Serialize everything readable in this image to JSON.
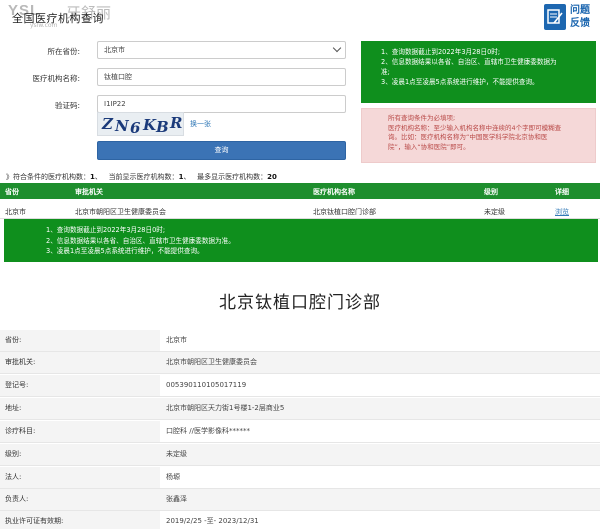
{
  "watermark": {
    "brand": "YSL",
    "brand_cn": "牙舒丽",
    "url": "yslw.com"
  },
  "app_title": "全国医疗机构查询",
  "feedback": {
    "line1": "问题",
    "line2": "反馈"
  },
  "form": {
    "province_label": "所在省份:",
    "province_value": "北京市",
    "name_label": "医疗机构名称:",
    "name_value": "钛植口腔",
    "captcha_label": "验证码:",
    "captcha_value": "I1IP22",
    "captcha_chars": [
      "Z",
      "N",
      "6",
      "K",
      "B",
      "R"
    ],
    "refresh_label": "换一张",
    "submit_label": "查询"
  },
  "notice_top": [
    "1、查询数据截止到2022年3月28日0时;",
    "2、信息数据结果以各省、自治区、直辖市卫生健康委数据为",
    "准;",
    "3、凌晨1点至凌晨5点系统进行维护，不能提供查询。"
  ],
  "notice_tip": {
    "line1": "所有查询条件为必填项;",
    "line2": "医疗机构名称：至少输入机构名称中连续的4个字即可模糊查",
    "line3": "询。比如：医疗机构名称为“中国医学科学院北京协和医",
    "line4": "院”，输入“协和医院”即可。"
  },
  "counts": {
    "matched_label": "》符合条件的医疗机构数：",
    "matched": "1",
    "shown_label": "当前显示医疗机构数：",
    "shown": "1",
    "max_label": "最多显示医疗机构数：",
    "max": "20"
  },
  "table": {
    "headers": [
      "省份",
      "审批机关",
      "医疗机构名称",
      "级别",
      "详细"
    ],
    "row": {
      "province": "北京市",
      "authority": "北京市朝阳区卫生健康委员会",
      "name": "北京钛植口腔门诊部",
      "level": "未定级",
      "detail": "浏览"
    }
  },
  "notice_bottom": [
    "1、查询数据截止到2022年3月28日0时;",
    "2、信息数据结果以各省、自治区、直辖市卫生健康委数据为准。",
    "3、凌晨1点至凌晨5点系统进行维护，不能提供查询。"
  ],
  "detail": {
    "title": "北京钛植口腔门诊部",
    "rows": [
      {
        "key": "省份:",
        "value": "北京市"
      },
      {
        "key": "审批机关:",
        "value": "北京市朝阳区卫生健康委员会"
      },
      {
        "key": "登记号:",
        "value": "005390110105017119"
      },
      {
        "key": "地址:",
        "value": "北京市朝阳区天力街1号楼1-2层商业5"
      },
      {
        "key": "诊疗科目:",
        "value": "口腔科 //医学影像科******"
      },
      {
        "key": "级别:",
        "value": "未定级"
      },
      {
        "key": "法人:",
        "value": "杨塬"
      },
      {
        "key": "负责人:",
        "value": "张鑫泽"
      },
      {
        "key": "执业许可证有效期:",
        "value": "2019/2/25 -至- 2023/12/31"
      }
    ]
  },
  "colors": {
    "green": "#0f8f1d",
    "blue": "#3b73b5",
    "pink": "#f5d8d8"
  }
}
